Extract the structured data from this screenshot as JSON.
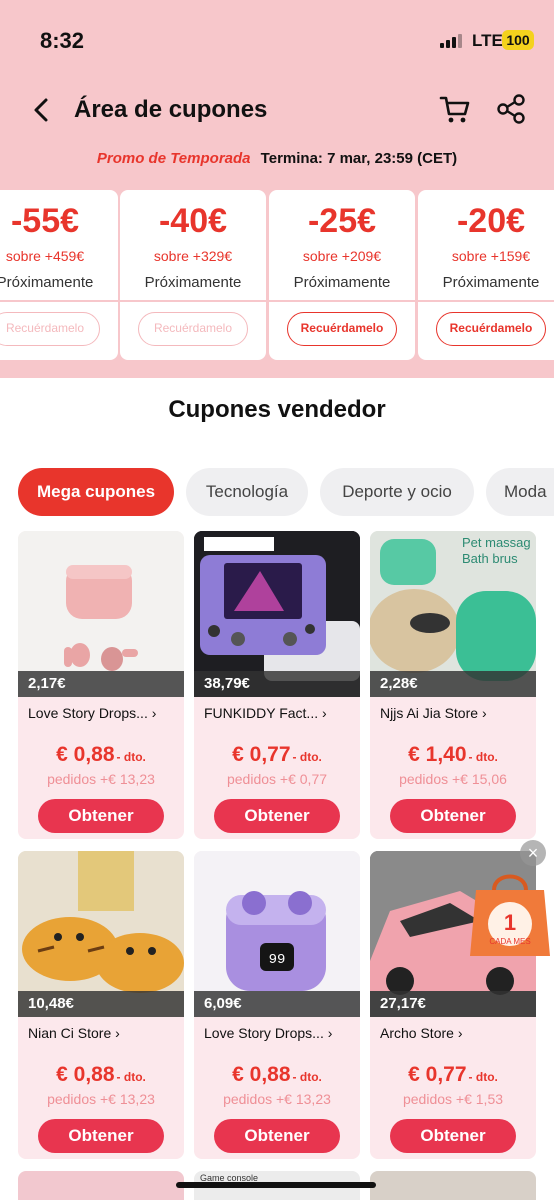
{
  "status": {
    "time": "8:32",
    "network": "LTE",
    "battery": "100"
  },
  "header": {
    "title": "Área de cupones",
    "back_icon": "chevron-left-icon",
    "cart_icon": "cart-icon",
    "share_icon": "share-icon"
  },
  "promo": {
    "tag": "Promo de Temporada",
    "ends": "Termina: 7 mar, 23:59 (CET)"
  },
  "coupons": [
    {
      "amount": "-55€",
      "min": "sobre +459€",
      "status": "Próximamente",
      "button": "Recuérdamelo"
    },
    {
      "amount": "-40€",
      "min": "sobre +329€",
      "status": "Próximamente",
      "button": "Recuérdamelo"
    },
    {
      "amount": "-25€",
      "min": "sobre +209€",
      "status": "Próximamente",
      "button": "Recuérdamelo"
    },
    {
      "amount": "-20€",
      "min": "sobre +159€",
      "status": "Próximamente",
      "button": "Recuérdamelo"
    }
  ],
  "section_title": "Cupones vendedor",
  "tabs": [
    "Mega cupones",
    "Tecnología",
    "Deporte y ocio",
    "Moda"
  ],
  "products": [
    {
      "price": "2,17€",
      "store": "Love Story Drops...",
      "discount": "€ 0,88",
      "dto": "- dto.",
      "orders": "pedidos +€ 13,23",
      "button": "Obtener"
    },
    {
      "price": "38,79€",
      "store": "FUNKIDDY Fact...",
      "discount": "€ 0,77",
      "dto": "- dto.",
      "orders": "pedidos +€ 0,77",
      "button": "Obtener"
    },
    {
      "price": "2,28€",
      "store": "Njjs Ai Jia Store",
      "discount": "€ 1,40",
      "dto": "- dto.",
      "orders": "pedidos +€ 15,06",
      "button": "Obtener"
    },
    {
      "price": "10,48€",
      "store": "Nian Ci Store",
      "discount": "€ 0,88",
      "dto": "- dto.",
      "orders": "pedidos +€ 13,23",
      "button": "Obtener"
    },
    {
      "price": "6,09€",
      "store": "Love Story Drops...",
      "discount": "€ 0,88",
      "dto": "- dto.",
      "orders": "pedidos +€ 13,23",
      "button": "Obtener"
    },
    {
      "price": "27,17€",
      "store": "Archo Store",
      "discount": "€ 0,77",
      "dto": "- dto.",
      "orders": "pedidos +€ 1,53",
      "button": "Obtener"
    }
  ],
  "image_text": {
    "pet_line1": "Pet massag",
    "pet_line2": "Bath brus",
    "earbuds_display": "99",
    "game_console": "Game console"
  },
  "floating_promo": {
    "line1": "1",
    "line2": "CADA MES"
  },
  "colors": {
    "accent": "#e8352c",
    "header_bg": "#f7c7cb",
    "card_bg": "#fce8ec",
    "button": "#e8354f"
  }
}
